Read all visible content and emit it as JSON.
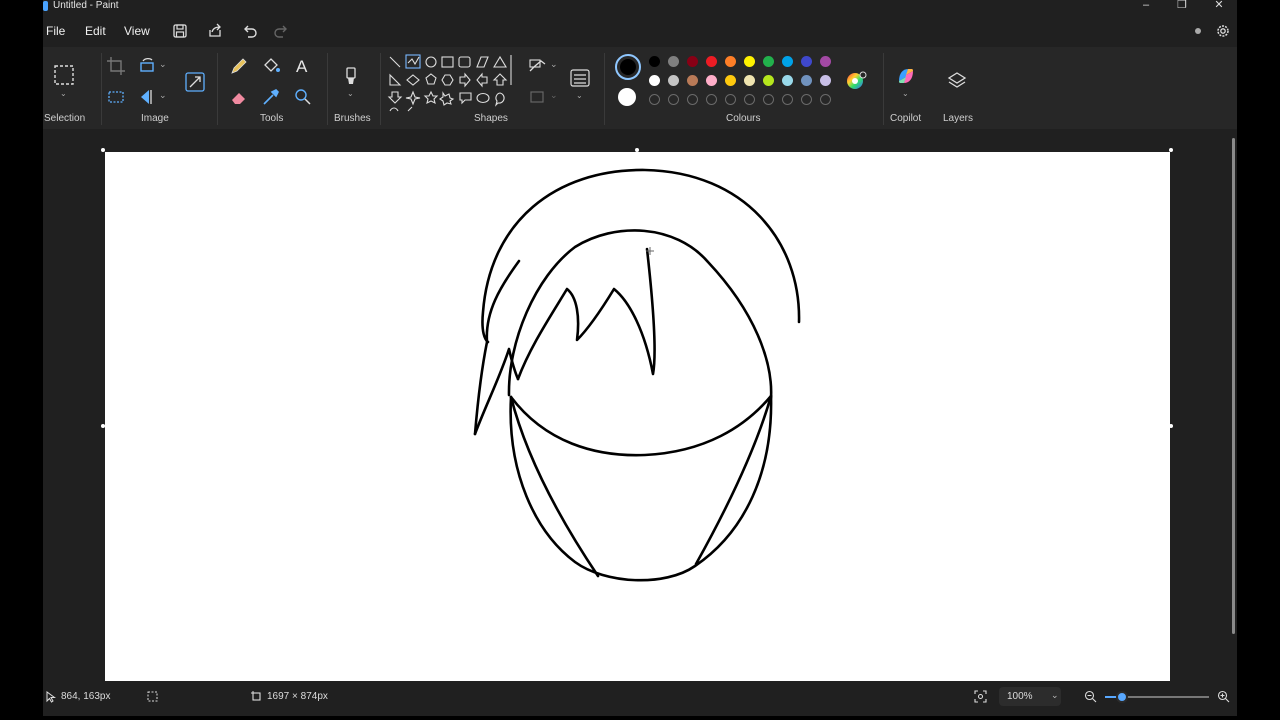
{
  "window": {
    "title": "Untitled - Paint",
    "minimize": "–",
    "restore": "❐",
    "close": "✕"
  },
  "menu": {
    "file": "File",
    "edit": "Edit",
    "view": "View"
  },
  "ribbon": {
    "groups": {
      "selection": "Selection",
      "image": "Image",
      "tools": "Tools",
      "brushes": "Brushes",
      "shapes": "Shapes",
      "colours": "Colours",
      "copilot": "Copilot",
      "layers": "Layers"
    },
    "text_tool_glyph": "A",
    "primary_color": "#000000",
    "secondary_color": "#ffffff",
    "palette_row1": [
      "#000000",
      "#7f7f7f",
      "#880015",
      "#ed1c24",
      "#ff7f27",
      "#fff200",
      "#22b14c",
      "#00a2e8",
      "#3f48cc",
      "#a349a4"
    ],
    "palette_row2": [
      "#ffffff",
      "#c3c3c3",
      "#b97a57",
      "#ffaec9",
      "#ffc90e",
      "#efe4b0",
      "#b5e61d",
      "#99d9ea",
      "#7092be",
      "#c8bfe7"
    ]
  },
  "status": {
    "cursor_position": "864, 163px",
    "canvas_size": "1697 × 874px",
    "zoom": "100%"
  }
}
